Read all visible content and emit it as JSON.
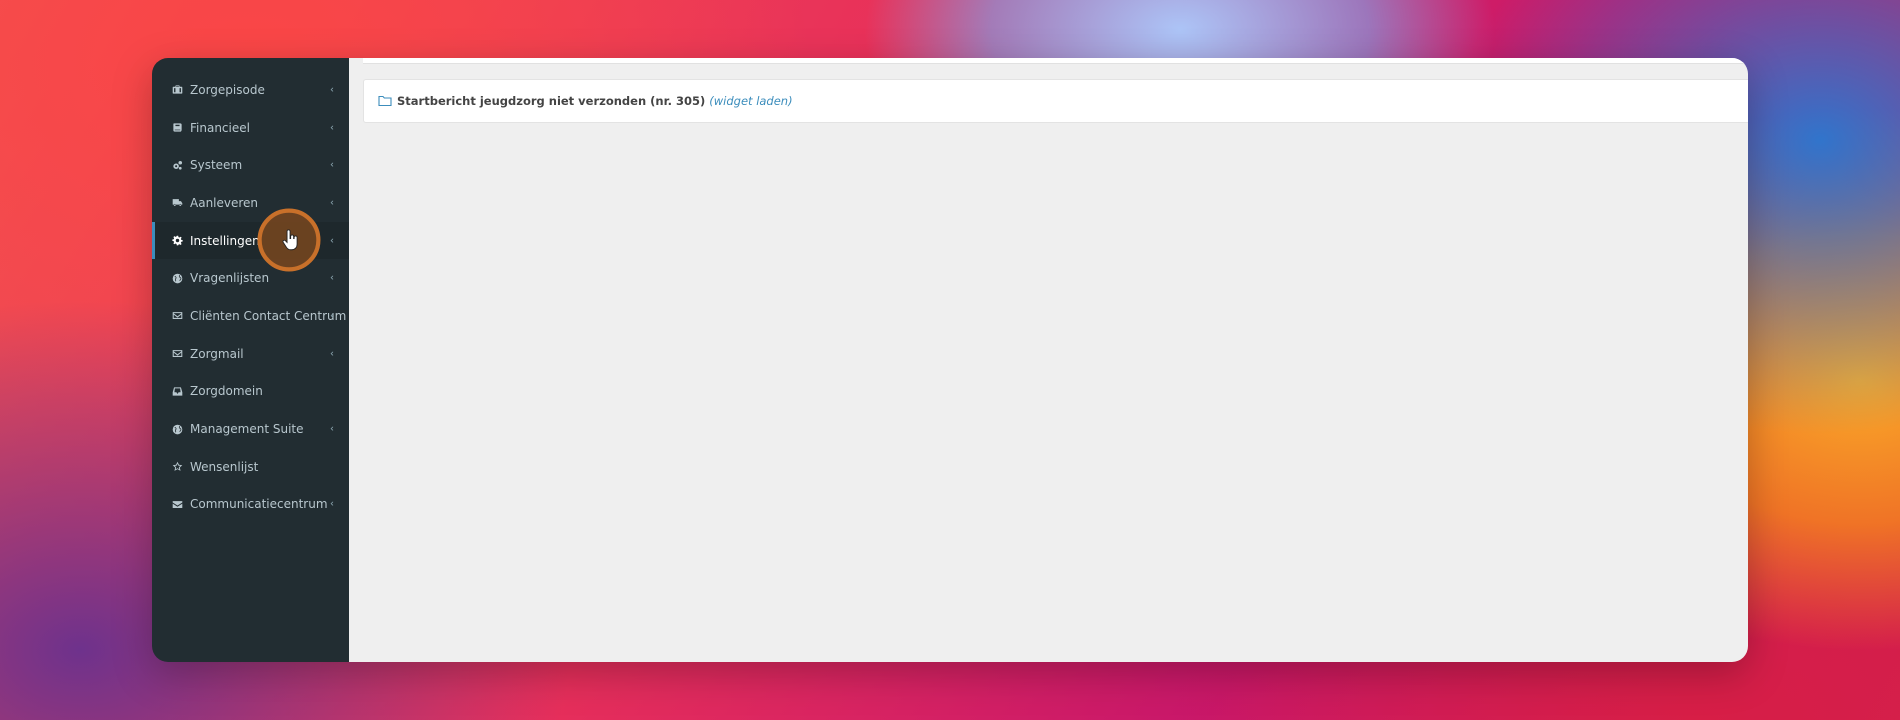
{
  "sidebar": {
    "items": [
      {
        "label": "Zorgepisode",
        "icon": "briefcase-icon",
        "chevron": "‹"
      },
      {
        "label": "Financieel",
        "icon": "book-icon",
        "chevron": "‹"
      },
      {
        "label": "Systeem",
        "icon": "cogs-icon",
        "chevron": "‹"
      },
      {
        "label": "Aanleveren",
        "icon": "truck-icon",
        "chevron": "‹"
      },
      {
        "label": "Instellingen",
        "icon": "gear-icon",
        "chevron": "‹",
        "active": true
      },
      {
        "label": "Vragenlijsten",
        "icon": "globe-icon",
        "chevron": "‹"
      },
      {
        "label": "Cliënten Contact Centrum",
        "icon": "envelope-icon",
        "chevron": "‹"
      },
      {
        "label": "Zorgmail",
        "icon": "envelope-icon",
        "chevron": "‹"
      },
      {
        "label": "Zorgdomein",
        "icon": "inbox-icon"
      },
      {
        "label": "Management Suite",
        "icon": "globe-icon",
        "chevron": "‹"
      },
      {
        "label": "Wensenlijst",
        "icon": "star-icon"
      },
      {
        "label": "Communicatiecentrum",
        "icon": "envelope-solid-icon",
        "chevron": "‹"
      }
    ]
  },
  "main": {
    "widget": {
      "icon": "folder-icon",
      "title": "Startbericht jeugdzorg niet verzonden (nr. 305)",
      "link": "(widget laden)"
    }
  },
  "colors": {
    "sidebar_bg": "#222d32",
    "sidebar_text": "#b8c7ce",
    "accent": "#3c8dbc",
    "content_bg": "#efefef"
  }
}
